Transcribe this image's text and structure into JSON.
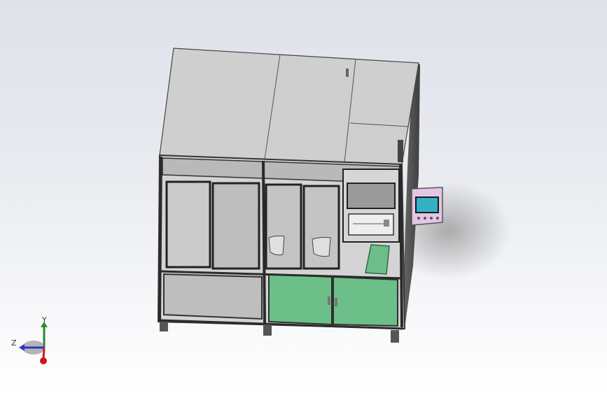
{
  "viewport": {
    "background_top": "#dfe2ea",
    "background_bottom": "#ffffff"
  },
  "model": {
    "frame_color": "#3a3a3a",
    "panel_color": "#c9c9c9",
    "roof_color": "#cfcfcf",
    "door_green": "#6dbf8a",
    "hmi_pink": "#e2c6e6",
    "hmi_screen": "#35b0c4"
  },
  "triad": {
    "y_label": "Y",
    "z_label": "Z",
    "y_color": "#2a8a2a",
    "z_color": "#2d34c8",
    "x_color": "#d01818"
  }
}
